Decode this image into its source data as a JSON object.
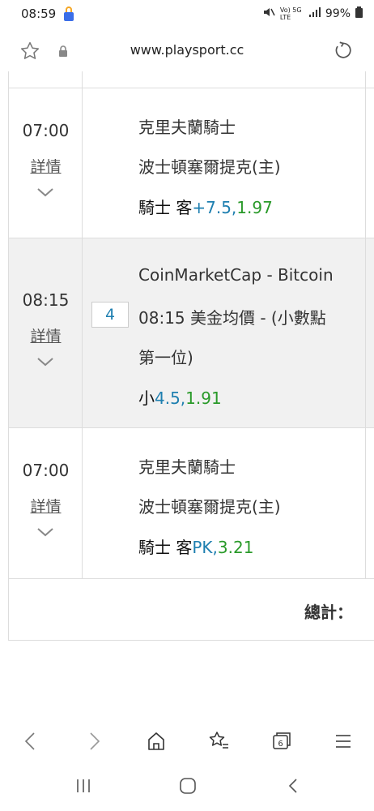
{
  "status_bar": {
    "time": "08:59",
    "network": "Vo) 5G LTE",
    "battery": "99%"
  },
  "browser": {
    "url": "www.playsport.cc"
  },
  "rows": [
    {
      "time": "07:00",
      "details": "詳情",
      "team1": "克里夫蘭騎士",
      "team2": "波士頓塞爾提克(主)",
      "bet_team": "騎士",
      "bet_side": "客",
      "bet_line": "+7.5,",
      "bet_odds": "1.97"
    },
    {
      "time": "08:15",
      "details": "詳情",
      "count": "4",
      "line1": "CoinMarketCap - Bitcoin",
      "line2": "08:15 美金均價 - (小數點",
      "line3": "第一位)",
      "bet_side": "小",
      "bet_line": "4.5,",
      "bet_odds": "1.91"
    },
    {
      "time": "07:00",
      "details": "詳情",
      "team1": "克里夫蘭騎士",
      "team2": "波士頓塞爾提克(主)",
      "bet_team": "騎士",
      "bet_side": "客",
      "bet_line": "PK,",
      "bet_odds": "3.21"
    }
  ],
  "summary": {
    "total_label": "總計："
  },
  "icons": {
    "lock": "lock-icon",
    "star": "star-icon",
    "padlock": "padlock-icon",
    "reload": "reload-icon",
    "back": "back-arrow-icon",
    "forward": "forward-arrow-icon",
    "home": "home-icon",
    "bookmarks": "bookmarks-icon",
    "tabs": "tabs-icon",
    "menu": "menu-icon"
  },
  "tabs_count": "6",
  "colors": {
    "accent_blue": "#1e7fb0",
    "odds_green": "#2a9a2a",
    "row_grey": "#f1f1f1"
  }
}
